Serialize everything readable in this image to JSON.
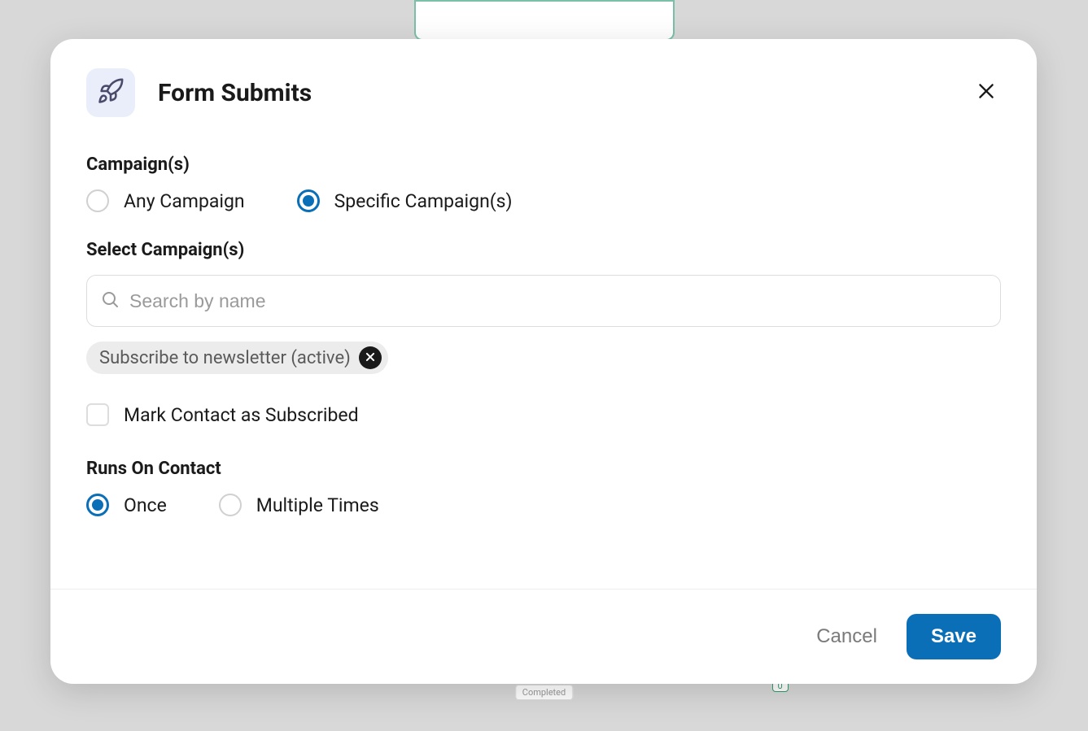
{
  "modal": {
    "title": "Form Submits",
    "campaigns": {
      "label": "Campaign(s)",
      "options": {
        "any": "Any Campaign",
        "specific": "Specific Campaign(s)"
      },
      "selected": "specific"
    },
    "select_campaigns": {
      "label": "Select Campaign(s)",
      "search_placeholder": "Search by name",
      "chip_text": "Subscribe to newsletter (active)"
    },
    "mark_subscribed": {
      "label": "Mark Contact as Subscribed",
      "checked": false
    },
    "runs_on_contact": {
      "label": "Runs On Contact",
      "options": {
        "once": "Once",
        "multiple": "Multiple Times"
      },
      "selected": "once"
    },
    "footer": {
      "cancel": "Cancel",
      "save": "Save"
    }
  },
  "background": {
    "completed_label": "Completed",
    "count": "0"
  }
}
